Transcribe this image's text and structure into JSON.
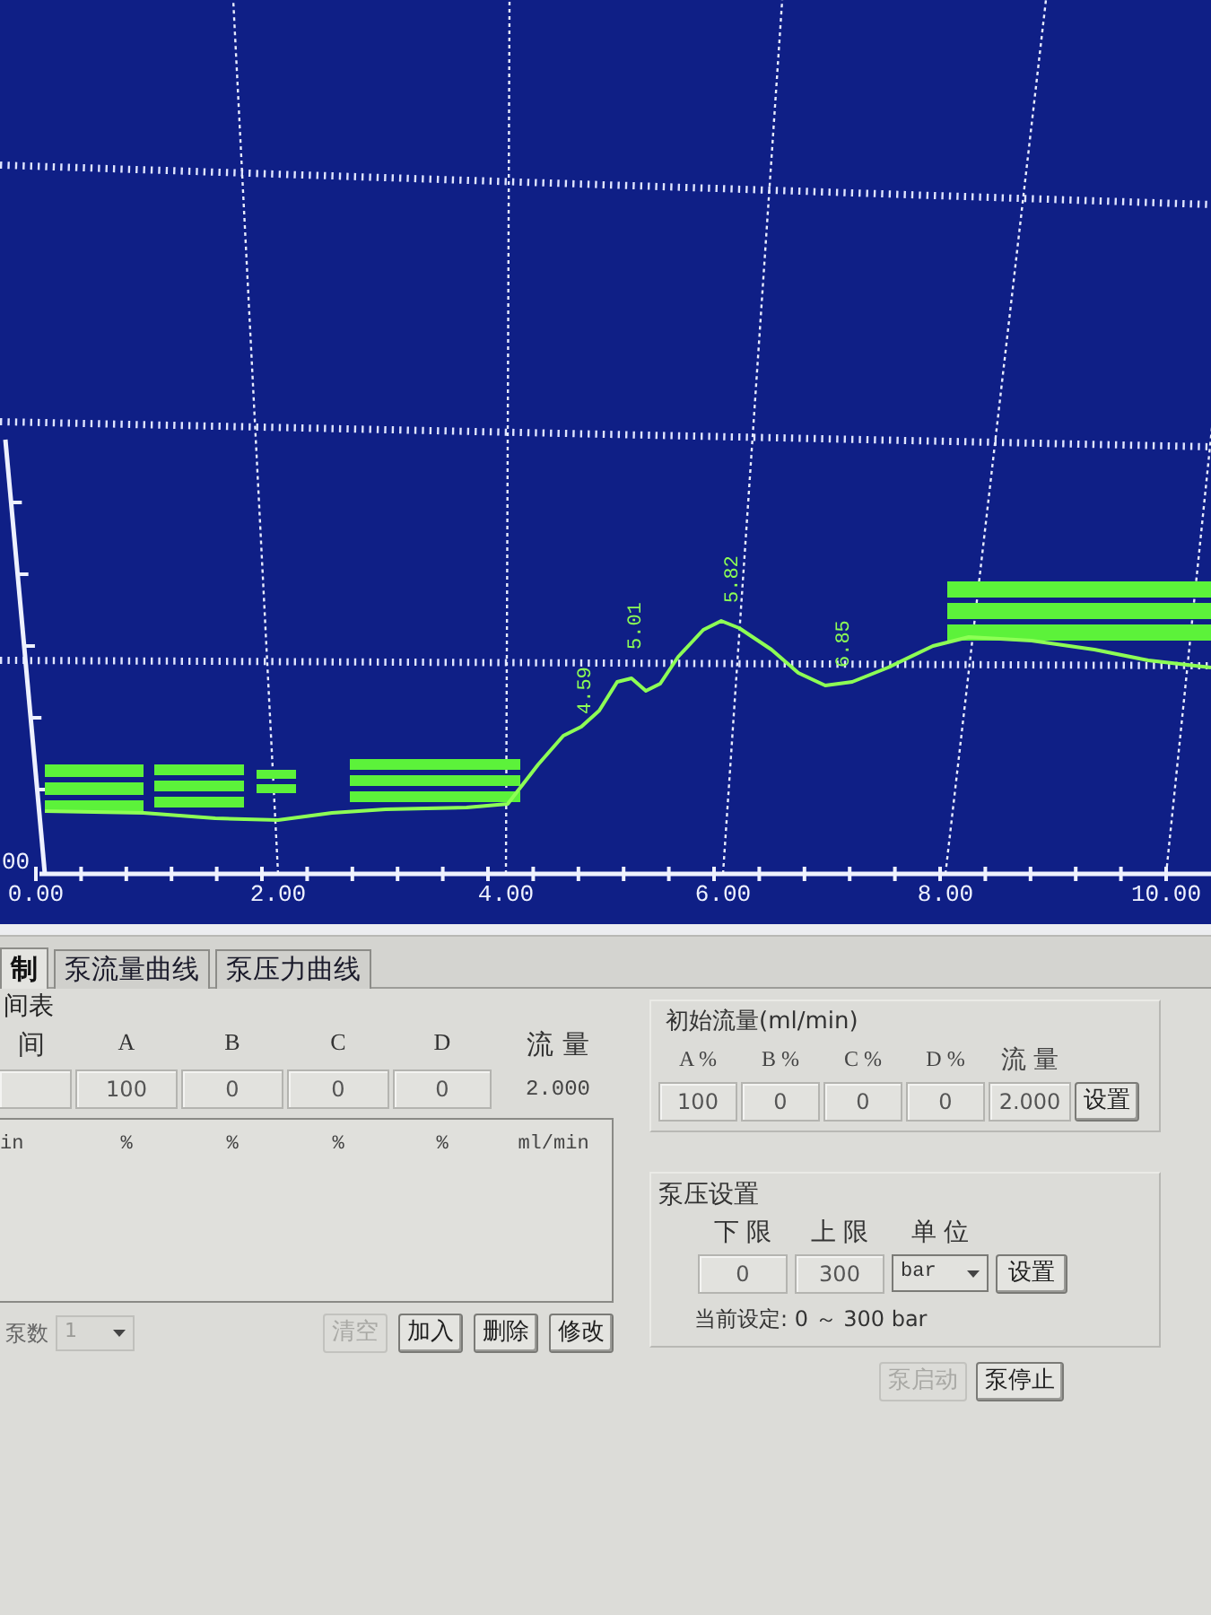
{
  "chart": {
    "y_tick_labels": [
      "00"
    ],
    "x_tick_labels": [
      "0.00",
      "2.00",
      "4.00",
      "6.00",
      "8.00",
      "10.00"
    ],
    "peak_labels": [
      "4.59",
      "5.01",
      "5.82",
      "6.85"
    ]
  },
  "tabs": [
    {
      "label": "制",
      "selected": true
    },
    {
      "label": "泵流量曲线",
      "selected": false
    },
    {
      "label": "泵压力曲线",
      "selected": false
    }
  ],
  "gradient_table": {
    "title": "间表",
    "columns": [
      "间",
      "A",
      "B",
      "C",
      "D",
      "流 量"
    ],
    "values": [
      "100",
      "0",
      "0",
      "0"
    ],
    "flow": "2.000",
    "list_columns": [
      "in",
      "%",
      "%",
      "%",
      "%",
      "ml/min"
    ],
    "pump_count": {
      "label": "泵数",
      "value": "1",
      "disabled": true
    },
    "buttons": [
      {
        "label": "清空",
        "disabled": true
      },
      {
        "label": "加入",
        "disabled": false
      },
      {
        "label": "删除",
        "disabled": false
      },
      {
        "label": "修改",
        "disabled": false
      }
    ]
  },
  "initial_flow": {
    "title": "初始流量(ml/min)",
    "columns": [
      "A %",
      "B %",
      "C %",
      "D %",
      "流 量"
    ],
    "values": [
      "100",
      "0",
      "0",
      "0",
      "2.000"
    ],
    "button": "设置"
  },
  "pressure": {
    "title": "泵压设置",
    "columns": [
      "下 限",
      "上 限",
      "单 位"
    ],
    "lower": "0",
    "upper": "300",
    "unit": "bar",
    "button": "设置",
    "current": "当前设定: 0 ～ 300 bar"
  },
  "pump_buttons": [
    {
      "label": "泵启动",
      "disabled": true
    },
    {
      "label": "泵停止",
      "disabled": false
    }
  ]
}
